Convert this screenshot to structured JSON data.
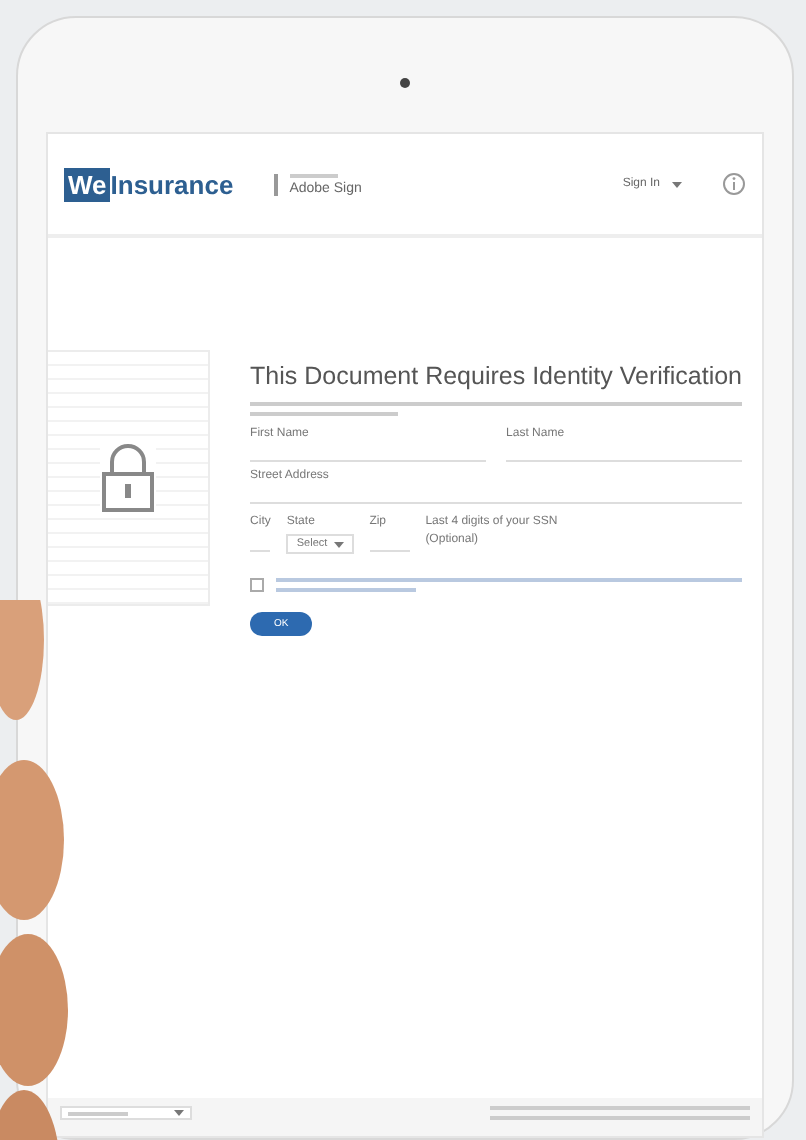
{
  "header": {
    "logo_mark": "We",
    "logo_text": "Insurance",
    "product": "Adobe Sign",
    "menu": "Sign In"
  },
  "document": {
    "title": "This Document Requires Identity Verification"
  },
  "form": {
    "fields": [
      {
        "label": "First Name",
        "kind": "text"
      },
      {
        "label": "Last Name",
        "kind": "text"
      },
      {
        "label": "Street Address",
        "kind": "wide"
      }
    ],
    "city": "City",
    "state": "State",
    "state_select": "Select",
    "zip": "Zip",
    "ssn": "Last 4 digits of your SSN",
    "ssn_note": "(Optional)",
    "consent": {
      "checked": false
    },
    "submit": "OK"
  }
}
